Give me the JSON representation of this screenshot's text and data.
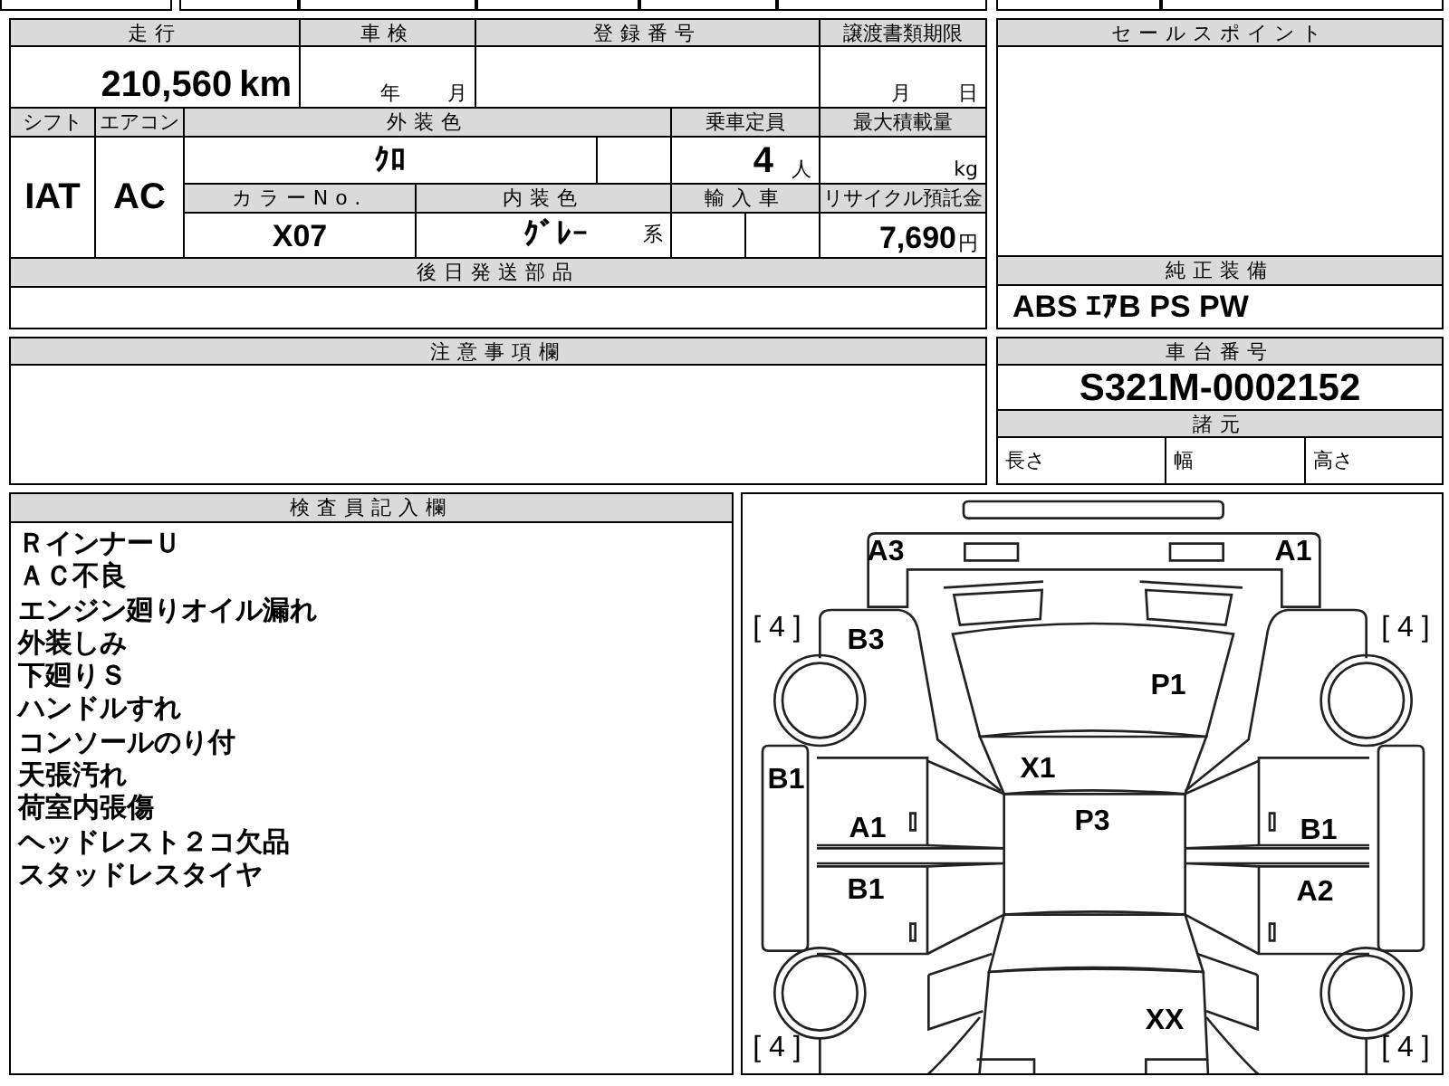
{
  "vehicle_table": {
    "mileage_label": "走行",
    "mileage": "210,560",
    "mileage_unit": "km",
    "inspection_label": "車検",
    "inspection_year_unit": "年",
    "inspection_month_unit": "月",
    "registration_label": "登録番号",
    "transfer_deadline_label": "譲渡書類期限",
    "transfer_month_unit": "月",
    "transfer_day_unit": "日",
    "shift_label": "シフト",
    "shift": "IAT",
    "ac_label": "エアコン",
    "ac": "AC",
    "exterior_color_label": "外装色",
    "exterior_color": "ｸﾛ",
    "capacity_label": "乗車定員",
    "capacity": "4",
    "capacity_unit": "人",
    "max_load_label": "最大積載量",
    "max_load_unit": "kg",
    "color_no_label": "カラーNo.",
    "color_no": "X07",
    "interior_color_label": "内装色",
    "interior_color": "ｸﾞﾚｰ",
    "interior_color_suffix": "系",
    "import_label": "輸入車",
    "recycle_fee_label": "リサイクル預託金",
    "recycle_fee": "7,690",
    "recycle_fee_unit": "円",
    "later_parts_label": "後日発送部品"
  },
  "sale_points": {
    "label": "セールスポイント"
  },
  "standard_equipment": {
    "label": "純正装備",
    "value": "ABS ｴｱB PS PW"
  },
  "notes": {
    "label": "注意事項欄"
  },
  "chassis": {
    "label": "車台番号",
    "number": "S321M-0002152",
    "specs_label": "諸元",
    "specs": [
      "長さ",
      "幅",
      "高さ"
    ]
  },
  "inspector": {
    "label": "検査員記入欄",
    "lines": [
      "ＲインナーＵ",
      "ＡＣ不良",
      "エンジン廻りオイル漏れ",
      "外装しみ",
      "下廻りＳ",
      "ハンドルすれ",
      "コンソールのり付",
      "天張汚れ",
      "荷室内張傷",
      "ヘッドレスト２コ欠品",
      "スタッドレスタイヤ"
    ]
  },
  "diagram": {
    "tread_depths": [
      "[ 4 ]",
      "[ 4 ]",
      "[ 4 ]",
      "[ 4 ]"
    ],
    "marks": [
      "A3",
      "A1",
      "B3",
      "P1",
      "X1",
      "P3",
      "B1",
      "A1",
      "B1",
      "B1",
      "A2",
      "XX"
    ]
  }
}
